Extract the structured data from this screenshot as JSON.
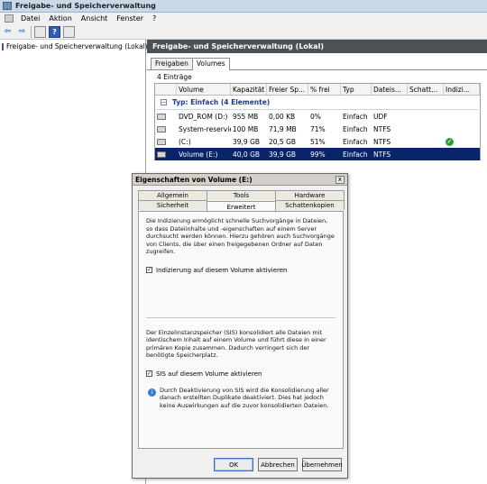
{
  "window": {
    "title": "Freigabe- und Speicherverwaltung"
  },
  "menu": [
    "Datei",
    "Aktion",
    "Ansicht",
    "Fenster",
    "?"
  ],
  "tree": {
    "root": "Freigabe- und Speicherverwaltung (Lokal)"
  },
  "main": {
    "header": "Freigabe- und Speicherverwaltung (Lokal)",
    "tabs": [
      "Freigaben",
      "Volumes"
    ],
    "active_tab": "Volumes",
    "count": "4 Einträge",
    "columns": [
      "Volume",
      "Kapazität",
      "Freier Sp...",
      "% frei",
      "Typ",
      "Dateis...",
      "Schatt...",
      "Indizi..."
    ],
    "group": "Typ: Einfach (4 Elemente)",
    "rows": [
      [
        "DVD_ROM (D:)",
        "955 MB",
        "0,00 KB",
        "0%",
        "Einfach",
        "UDF",
        "",
        ""
      ],
      [
        "System-reserviert",
        "100 MB",
        "71,9 MB",
        "71%",
        "Einfach",
        "NTFS",
        "",
        ""
      ],
      [
        "(C:)",
        "39,9 GB",
        "20,5 GB",
        "51%",
        "Einfach",
        "NTFS",
        "",
        "check"
      ],
      [
        "Volume (E:)",
        "40,0 GB",
        "39,9 GB",
        "99%",
        "Einfach",
        "NTFS",
        "",
        ""
      ]
    ],
    "selected_row": 3
  },
  "dialog": {
    "title": "Eigenschaften von Volume (E:)",
    "close": "x",
    "tabs_row1": [
      "Allgemein",
      "Tools",
      "Hardware"
    ],
    "tabs_row2": [
      "Sicherheit",
      "Erweitert",
      "Schattenkopien"
    ],
    "active_tab": "Erweitert",
    "indexing_text": "Die Indizierung ermöglicht schnelle Suchvorgänge in Dateien, so dass Dateiinhalte und -eigenschaften auf einem Server durchsucht werden können. Hierzu gehören auch Suchvorgänge von Clients, die über einen freigegebenen Ordner auf Daten zugreifen.",
    "indexing_checkbox": "Indizierung auf diesem Volume aktivieren",
    "indexing_checked": true,
    "sis_text": "Der Einzelinstanzspeicher (SIS) konsolidiert alle Dateien mit identischem Inhalt auf einem Volume und führt diese in einer primären Kopie zusammen. Dadurch verringert sich der benötigte Speicherplatz.",
    "sis_checkbox": "SIS auf diesem Volume aktivieren",
    "sis_checked": true,
    "sis_info": "Durch Deaktivierung von SIS wird die Konsolidierung aller danach erstellten Duplikate deaktiviert. Dies hat jedoch keine Auswirkungen auf die zuvor konsolidierten Dateien.",
    "buttons": {
      "ok": "OK",
      "cancel": "Abbrechen",
      "apply": "Übernehmen"
    }
  }
}
